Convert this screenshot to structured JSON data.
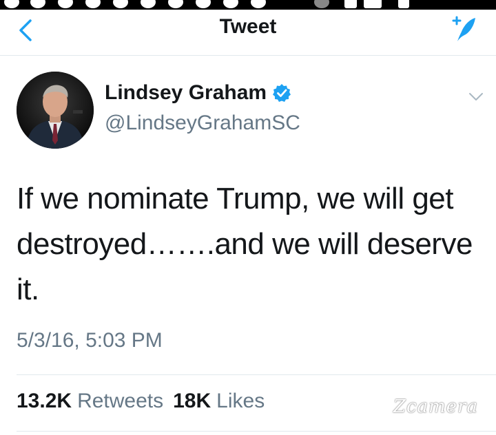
{
  "nav": {
    "title": "Tweet",
    "back_icon": "chevron-left-icon",
    "compose_icon": "compose-tweet-icon",
    "accent": "#1da1f2"
  },
  "tweet": {
    "author_name": "Lindsey Graham",
    "verified": true,
    "handle": "@LindseyGrahamSC",
    "text": "If we nominate Trump, we will get destroyed…….and we will deserve it.",
    "timestamp": "5/3/16, 5:03 PM",
    "retweets_count": "13.2K",
    "retweets_label": "Retweets",
    "likes_count": "18K",
    "likes_label": "Likes"
  },
  "watermark": "Zcamera",
  "colors": {
    "text": "#14171a",
    "secondary": "#657786",
    "divider": "#e1e8ed",
    "verified": "#1da1f2"
  }
}
